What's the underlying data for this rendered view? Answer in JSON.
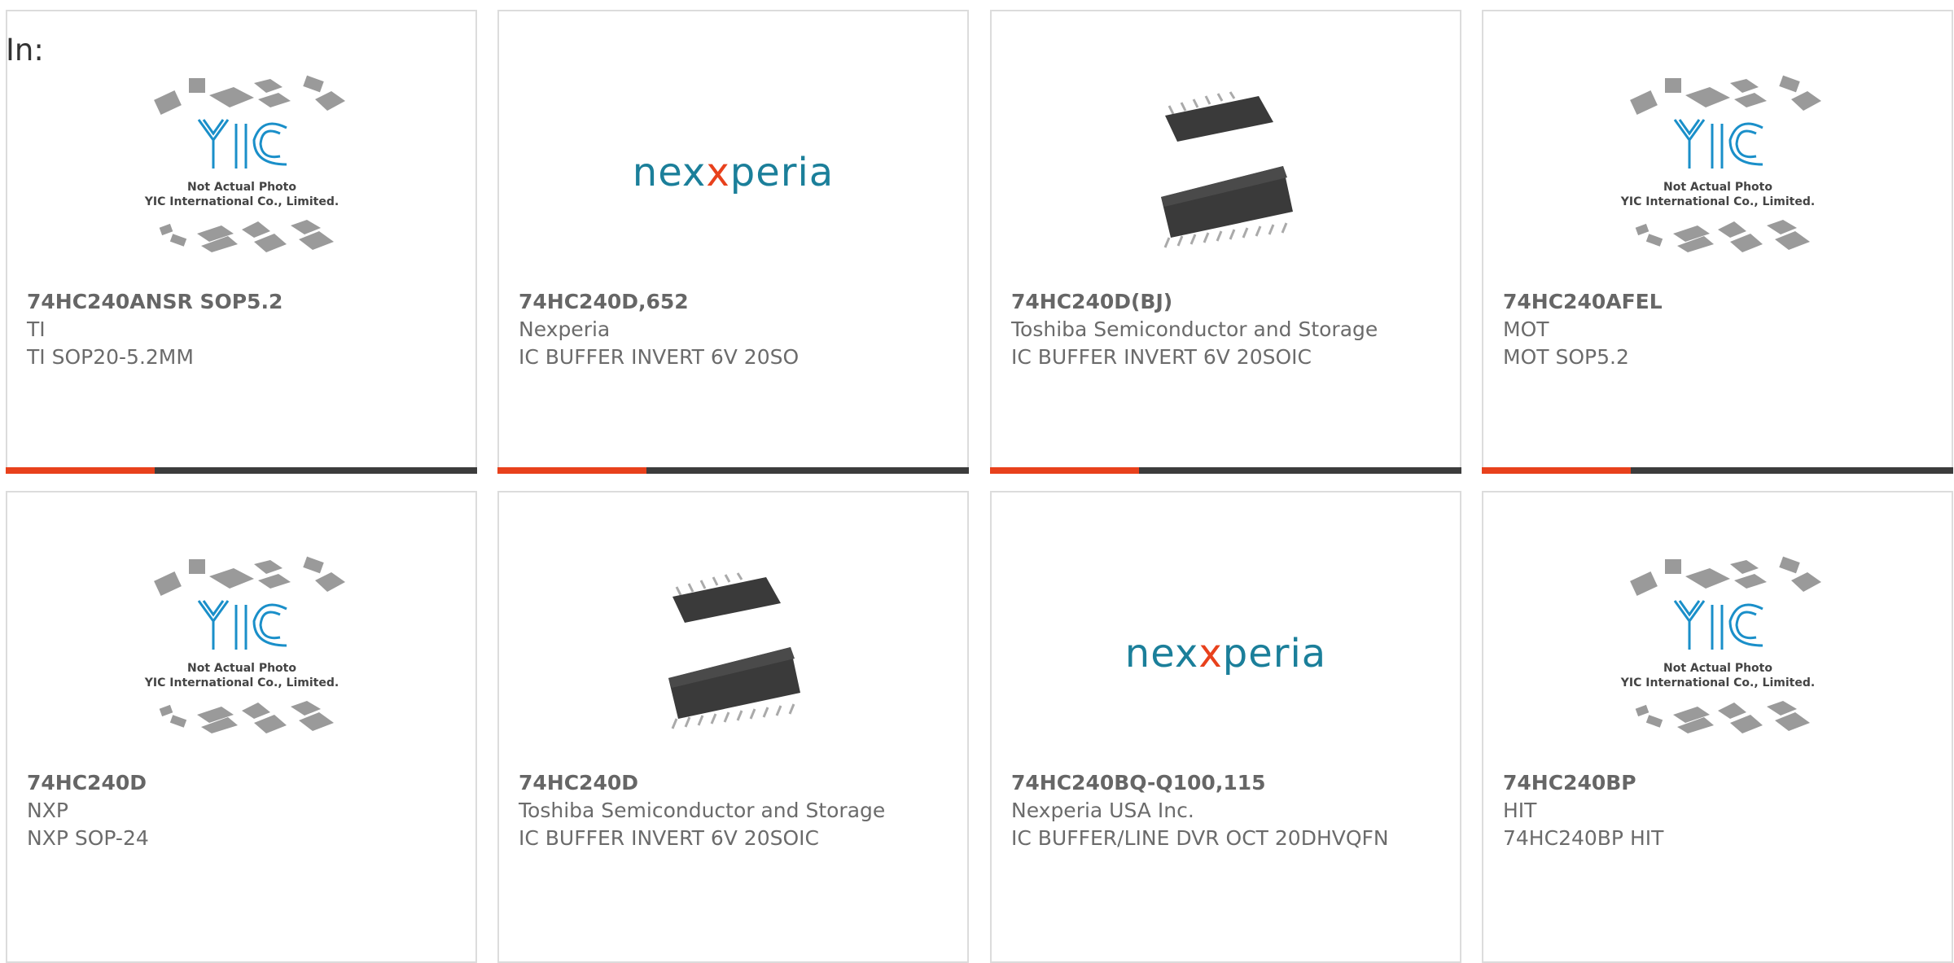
{
  "filter": {
    "label": "In:"
  },
  "colors": {
    "accent": "#e8411c",
    "bar": "#3c3c3c",
    "teal": "#1b7f9a",
    "yic_blue": "#1a8fc9"
  },
  "placeholder": {
    "line1": "Not Actual Photo",
    "line2": "YIC International Co., Limited."
  },
  "brand": {
    "nexperia": "nexperia"
  },
  "products": [
    {
      "part": "74HC240ANSR SOP5.2",
      "mfr": "TI",
      "desc": "TI SOP20-5.2MM",
      "image": "yic-placeholder"
    },
    {
      "part": "74HC240D,652",
      "mfr": "Nexperia",
      "desc": "IC BUFFER INVERT 6V 20SO",
      "image": "nexperia-logo"
    },
    {
      "part": "74HC240D(BJ)",
      "mfr": "Toshiba Semiconductor and Storage",
      "desc": "IC BUFFER INVERT 6V 20SOIC",
      "image": "soic-chip"
    },
    {
      "part": "74HC240AFEL",
      "mfr": "MOT",
      "desc": "MOT SOP5.2",
      "image": "yic-placeholder"
    },
    {
      "part": "74HC240D",
      "mfr": "NXP",
      "desc": "NXP SOP-24",
      "image": "yic-placeholder"
    },
    {
      "part": "74HC240D",
      "mfr": "Toshiba Semiconductor and Storage",
      "desc": "IC BUFFER INVERT 6V 20SOIC",
      "image": "soic-chip"
    },
    {
      "part": "74HC240BQ-Q100,115",
      "mfr": "Nexperia USA Inc.",
      "desc": "IC BUFFER/LINE DVR OCT 20DHVQFN",
      "image": "nexperia-logo"
    },
    {
      "part": "74HC240BP",
      "mfr": "HIT",
      "desc": "74HC240BP HIT",
      "image": "yic-placeholder"
    }
  ]
}
